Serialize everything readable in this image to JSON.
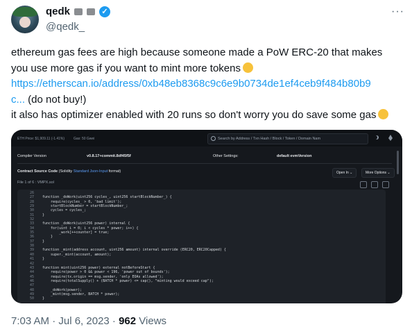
{
  "author": {
    "name": "qedk",
    "handle": "@qedk_"
  },
  "menu_glyph": "···",
  "tweet": {
    "line1": "ethereum gas fees are high because someone made a PoW ERC-20 that makes",
    "line2": "you use more gas if you want to mint more tokens",
    "link": "https://etherscan.io/address/0xb48eb8368c9c6e9b0734de1ef4ceb9f484b80b9",
    "link_tail": "c...",
    "line3_rest": " (do not buy!)",
    "line4": "it also has optimizer enabled with 20 runs so don't worry you do save some gas"
  },
  "screenshot": {
    "eth_price": "ETH Price: $1,909.11 (-1.41%)",
    "gas": "Gas: 50 Gwei",
    "search_placeholder": "Search by Address / Txn Hash / Block / Token / Domain Nam",
    "compiler_label": "Compiler Version",
    "compiler_value": "v0.8.17+commit.8df45f5f",
    "other_settings_label": "Other Settings:",
    "other_settings_value": "default evmVersion",
    "contract_source_title": "Contract Source Code",
    "solidity_pre": "(Solidity ",
    "solidity_link": "Standard Json-Input",
    "solidity_post": " format)",
    "open_in": "Open In ⌄",
    "more_options": "More Options ⌄",
    "file": "File 1 of 6 : VMPX.sol",
    "line_numbers": "26\n27\n28\n29\n30\n31\n32\n33\n34\n35\n36\n37\n38\n39\n40\n41\n42\n43\n44\n45\n46\n47\n48\n49\n50",
    "code": "\nfunction _doWork(uint256 cycles_, uint256 startBlockNumber_) {\n    require(cycles_ > 0, 'bad limit');\n    startBlockNumber = startBlockNumber_;\n    cycles = cycles_;\n}\n\nfunction _doWork(uint256 power) internal {\n    for(uint i = 0; i < cycles * power; i++) {\n        _work[++counter] = true;\n    }\n}\n\nfunction _mint(address account, uint256 amount) internal override (ERC20, ERC20Capped) {\n    super._mint(account, amount);\n}\n\nfunction mint(uint256 power) external notBeforeStart {\n    require(power > 0 && power < 196, 'power out of bounds');\n    require(tx.origin == msg.sender, 'only EOAs allowed');\n    require(totalSupply() + (BATCH * power) <= cap(), \"minting would exceed cap\");\n\n    _doWork(power);\n    _mint(msg.sender, BATCH * power);\n}"
  },
  "footer": {
    "time": "7:03 AM · Jul 6, 2023 · ",
    "views_count": "962",
    "views_label": " Views"
  }
}
